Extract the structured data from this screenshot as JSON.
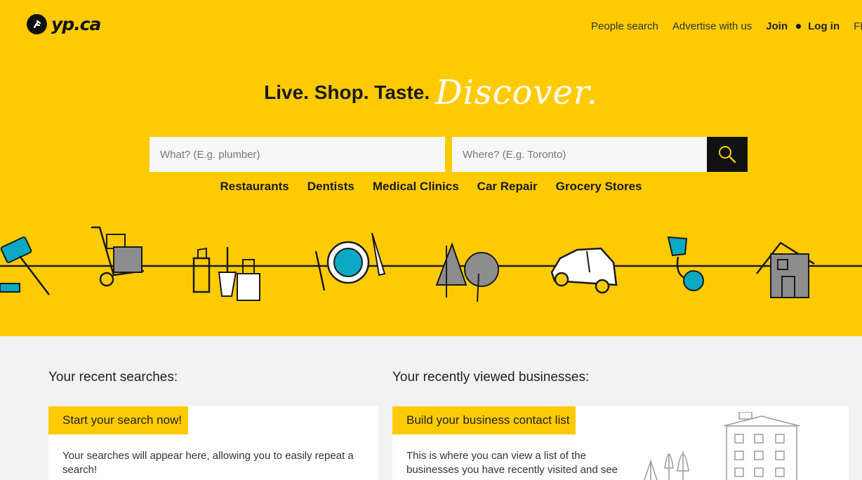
{
  "brand": {
    "logo_text": "yp.ca"
  },
  "nav": {
    "people_search": "People search",
    "advertise": "Advertise with us",
    "join": "Join",
    "login": "Log in",
    "lang": "FR"
  },
  "headline": {
    "main": "Live. Shop. Taste.",
    "script": "Discover."
  },
  "search": {
    "what_placeholder": "What? (E.g. plumber)",
    "where_placeholder": "Where? (E.g. Toronto)"
  },
  "quick_links": [
    "Restaurants",
    "Dentists",
    "Medical Clinics",
    "Car Repair",
    "Grocery Stores"
  ],
  "recent_searches": {
    "title": "Your recent searches:",
    "tag": "Start your search now!",
    "body_line1": "Your searches will appear here, allowing you to easily repeat a",
    "body_line2": "search!"
  },
  "recent_businesses": {
    "title": "Your recently viewed businesses:",
    "tag": "Build your business contact list",
    "body_line1": "This is where you can view a list of the",
    "body_line2": "businesses you have recently visited and see"
  },
  "colors": {
    "brand_yellow": "#fecb03",
    "accent_teal": "#0aa8c3",
    "illustration_gray": "#8d8d8d",
    "ink": "#1a1a1a"
  }
}
